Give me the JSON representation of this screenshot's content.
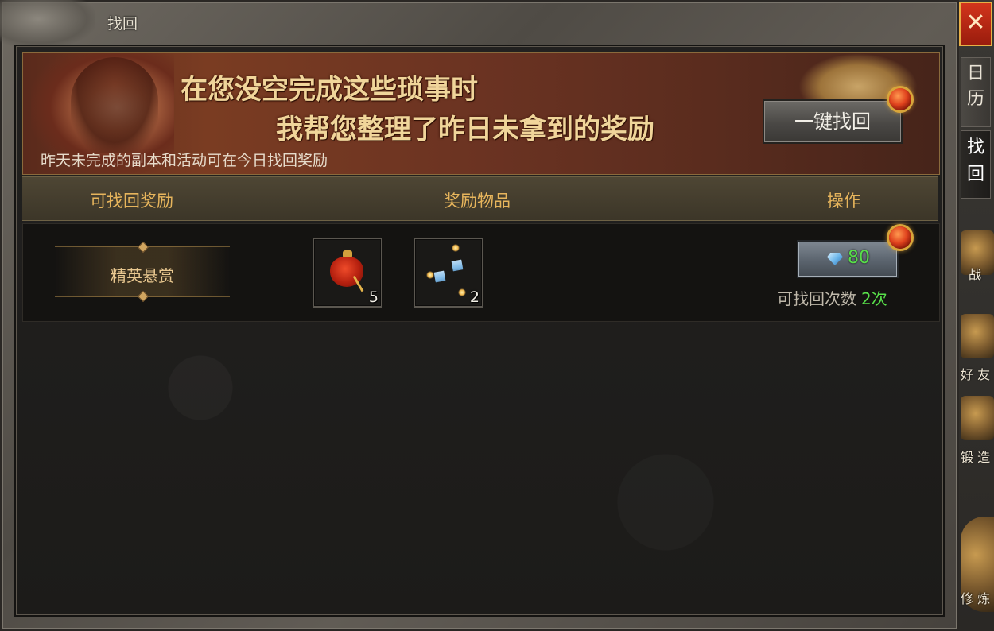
{
  "window": {
    "title": "找回"
  },
  "banner": {
    "line1": "在您没空完成这些琐事时",
    "line2": "我帮您整理了昨日未拿到的奖励",
    "note": "昨天未完成的副本和活动可在今日找回奖励",
    "one_click_label": "一键找回"
  },
  "table": {
    "headers": [
      "可找回奖励",
      "奖励物品",
      "操作"
    ],
    "rows": [
      {
        "name": "精英悬赏",
        "items": [
          {
            "icon": "red-pouch-icon",
            "count": "5"
          },
          {
            "icon": "crystal-shard-icon",
            "count": "2"
          }
        ],
        "cost": "80",
        "times_label": "可找回次数",
        "times_value": "2次"
      }
    ]
  },
  "side": {
    "close_label": "✕",
    "tabs": [
      "日历",
      "找回"
    ],
    "labels": [
      "战",
      "好 友",
      "锻 造",
      "修 炼"
    ]
  },
  "colors": {
    "accent_gold": "#e7b55c",
    "green_value": "#58e04a",
    "close_red": "#d2351c"
  }
}
